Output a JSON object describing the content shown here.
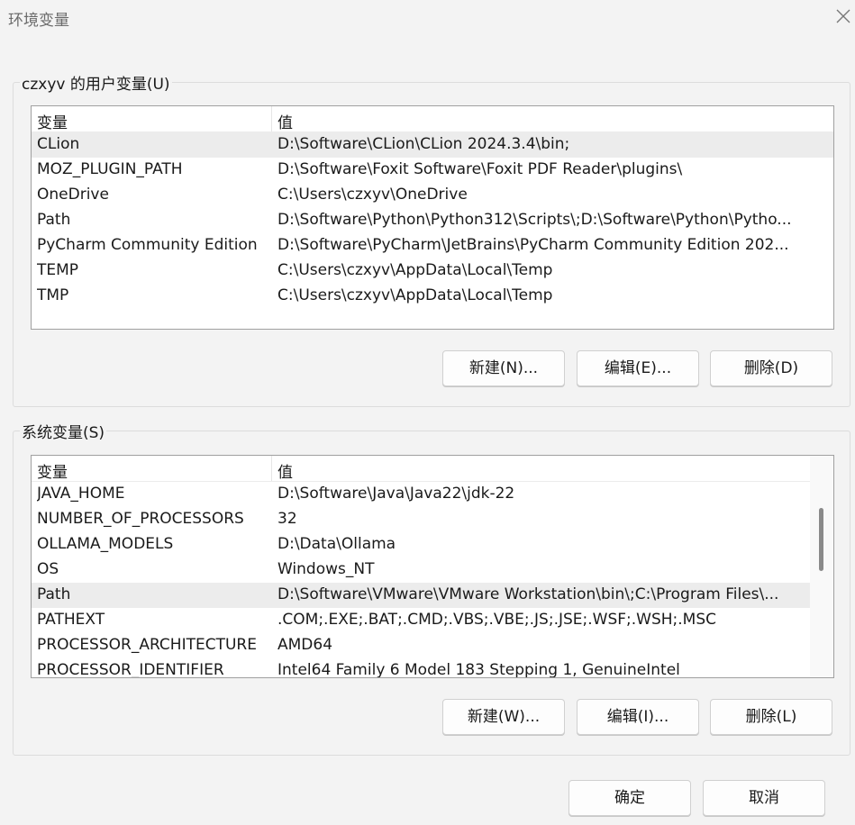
{
  "window": {
    "title": "环境变量"
  },
  "user_group": {
    "label": "czxyv 的用户变量(U)",
    "header": {
      "name": "变量",
      "value": "值"
    },
    "rows": [
      {
        "name": "CLion",
        "value": "D:\\Software\\CLion\\CLion 2024.3.4\\bin;",
        "selected": true
      },
      {
        "name": "MOZ_PLUGIN_PATH",
        "value": "D:\\Software\\Foxit Software\\Foxit PDF Reader\\plugins\\"
      },
      {
        "name": "OneDrive",
        "value": "C:\\Users\\czxyv\\OneDrive"
      },
      {
        "name": "Path",
        "value": "D:\\Software\\Python\\Python312\\Scripts\\;D:\\Software\\Python\\Pytho..."
      },
      {
        "name": "PyCharm Community Edition",
        "value": "D:\\Software\\PyCharm\\JetBrains\\PyCharm Community Edition 202..."
      },
      {
        "name": "TEMP",
        "value": "C:\\Users\\czxyv\\AppData\\Local\\Temp"
      },
      {
        "name": "TMP",
        "value": "C:\\Users\\czxyv\\AppData\\Local\\Temp"
      }
    ],
    "buttons": {
      "new": "新建(N)...",
      "edit": "编辑(E)...",
      "delete": "删除(D)"
    }
  },
  "system_group": {
    "label": "系统变量(S)",
    "header": {
      "name": "变量",
      "value": "值"
    },
    "rows": [
      {
        "name": "JAVA_HOME",
        "value": "D:\\Software\\Java\\Java22\\jdk-22"
      },
      {
        "name": "NUMBER_OF_PROCESSORS",
        "value": "32"
      },
      {
        "name": "OLLAMA_MODELS",
        "value": "D:\\Data\\Ollama"
      },
      {
        "name": "OS",
        "value": "Windows_NT"
      },
      {
        "name": "Path",
        "value": "D:\\Software\\VMware\\VMware Workstation\\bin\\;C:\\Program Files\\...",
        "selected": true
      },
      {
        "name": "PATHEXT",
        "value": ".COM;.EXE;.BAT;.CMD;.VBS;.VBE;.JS;.JSE;.WSF;.WSH;.MSC"
      },
      {
        "name": "PROCESSOR_ARCHITECTURE",
        "value": "AMD64"
      },
      {
        "name": "PROCESSOR_IDENTIFIER",
        "value": "Intel64 Family 6 Model 183 Stepping 1, GenuineIntel"
      }
    ],
    "buttons": {
      "new": "新建(W)...",
      "edit": "编辑(I)...",
      "delete": "删除(L)"
    }
  },
  "footer": {
    "ok": "确定",
    "cancel": "取消"
  }
}
